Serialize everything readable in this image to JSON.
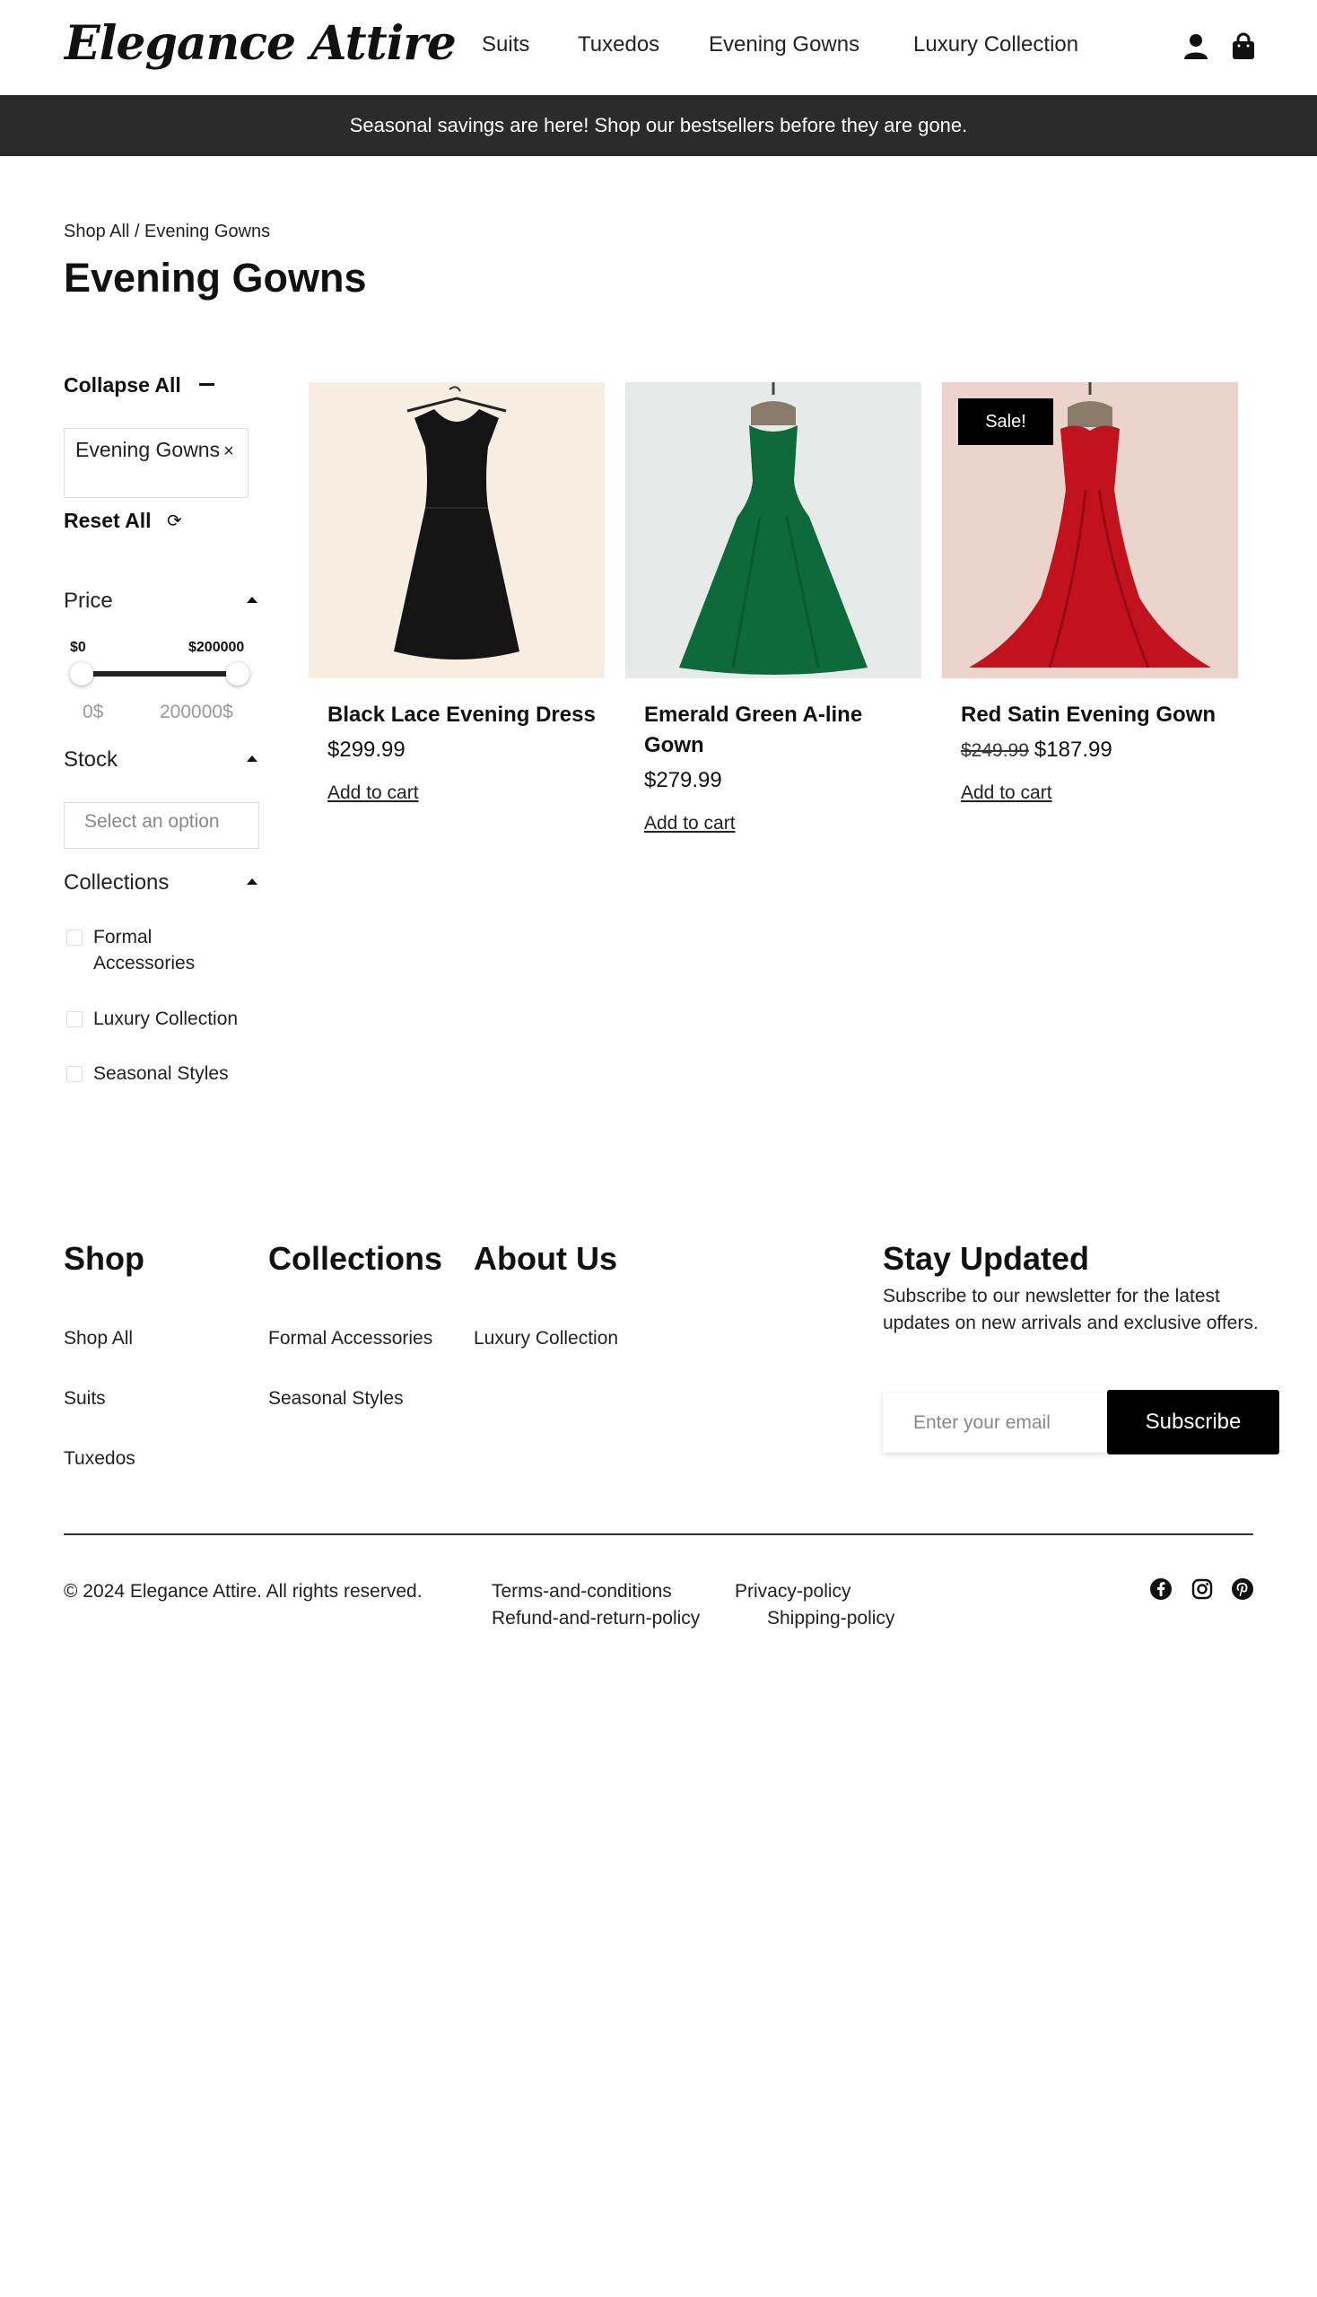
{
  "header": {
    "logo": "Elegance Attire",
    "nav": [
      "Suits",
      "Tuxedos",
      "Evening Gowns",
      "Luxury Collection"
    ],
    "icons": [
      "user-icon",
      "shopping-bag-icon"
    ]
  },
  "banner": {
    "text": "Seasonal savings are here! Shop our bestsellers before they are gone."
  },
  "breadcrumb": "Shop All / Evening Gowns",
  "page_title": "Evening Gowns",
  "sidebar": {
    "collapse_all": "Collapse All",
    "active_filter": "Evening Gowns",
    "remove_symbol": "×",
    "reset_all": "Reset All",
    "price": {
      "label": "Price",
      "min_label": "$0",
      "max_label": "$200000",
      "min_value": "0$",
      "max_value": "200000$",
      "range": [
        0,
        200000
      ]
    },
    "stock": {
      "label": "Stock",
      "placeholder": "Select an option"
    },
    "collections": {
      "label": "Collections",
      "options": [
        "Formal Accessories",
        "Luxury Collection",
        "Seasonal Styles"
      ]
    }
  },
  "products": [
    {
      "name": "Black Lace Evening Dress",
      "price": "$299.99",
      "old_price": "",
      "sale": false,
      "cart": "Add to cart"
    },
    {
      "name": "Emerald Green A-line Gown",
      "price": "$279.99",
      "old_price": "",
      "sale": false,
      "cart": "Add to cart"
    },
    {
      "name": "Red Satin Evening Gown",
      "price": "$187.99",
      "old_price": "$249.99",
      "sale": true,
      "badge": "Sale!",
      "cart": "Add to cart"
    }
  ],
  "footer": {
    "shop": {
      "title": "Shop",
      "links": [
        "Shop All",
        "Suits",
        "Tuxedos"
      ]
    },
    "collections": {
      "title": "Collections",
      "links": [
        "Formal Accessories",
        "Seasonal Styles"
      ]
    },
    "about": {
      "title": "About Us",
      "links": [
        "Luxury Collection"
      ]
    },
    "newsletter": {
      "title": "Stay Updated",
      "text": "Subscribe to our newsletter for the latest updates on new arrivals and exclusive offers.",
      "placeholder": "Enter your email",
      "button": "Subscribe"
    },
    "copyright": "© 2024 Elegance Attire. All rights reserved.",
    "legal": [
      "Terms-and-conditions",
      "Privacy-policy",
      "Refund-and-return-policy",
      "Shipping-policy"
    ],
    "social": [
      "facebook-icon",
      "instagram-icon",
      "pinterest-icon"
    ]
  }
}
